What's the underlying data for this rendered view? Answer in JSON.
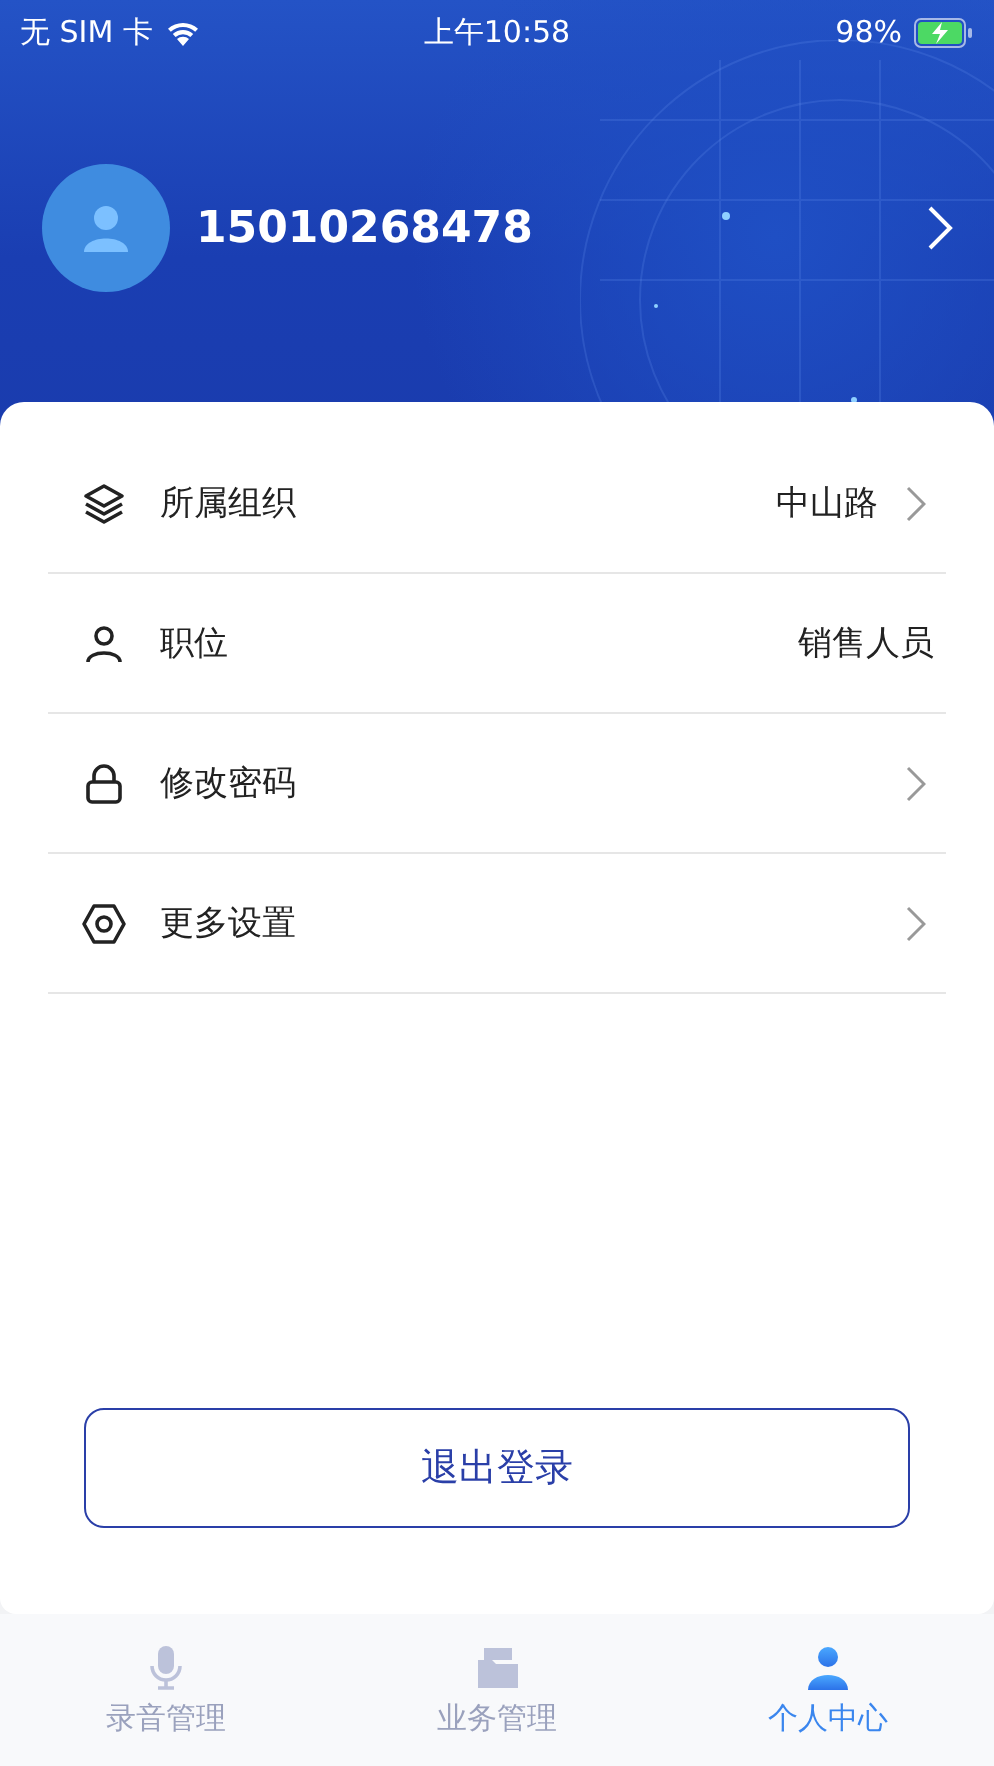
{
  "status_bar": {
    "carrier": "无 SIM 卡",
    "time": "上午10:58",
    "battery": "98%"
  },
  "profile": {
    "phone": "15010268478"
  },
  "menu": [
    {
      "label": "所属组织",
      "value": "中山路",
      "navigable": true
    },
    {
      "label": "职位",
      "value": "销售人员",
      "navigable": false
    },
    {
      "label": "修改密码",
      "navigable": true
    },
    {
      "label": "更多设置",
      "navigable": true
    }
  ],
  "logout_button": "退出登录",
  "tabs": [
    {
      "label": "录音管理",
      "selected": false
    },
    {
      "label": "业务管理",
      "selected": false
    },
    {
      "label": "个人中心",
      "selected": true
    }
  ]
}
